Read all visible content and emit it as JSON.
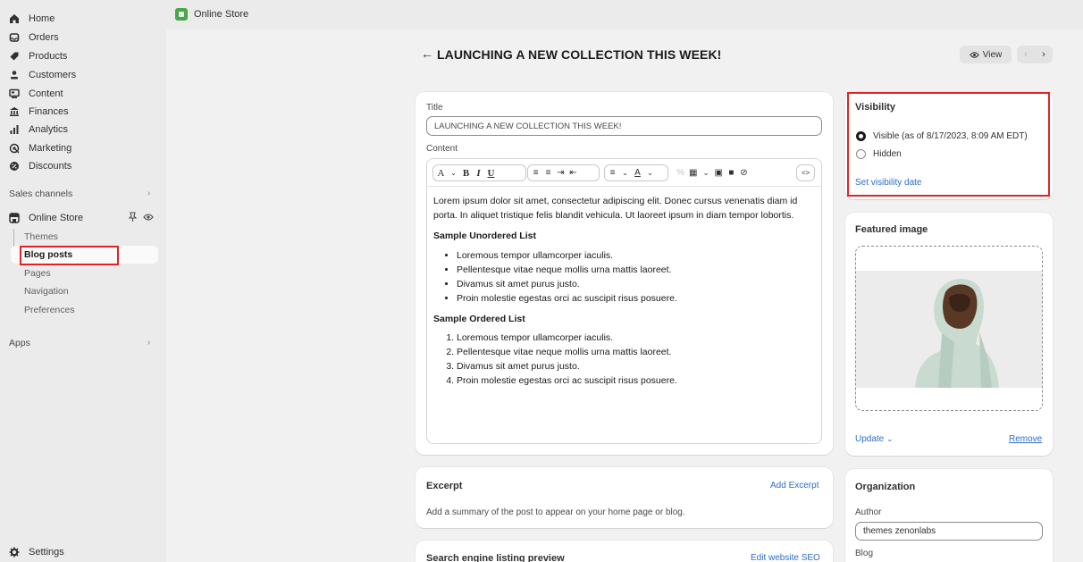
{
  "sidebar": {
    "items": [
      {
        "label": "Home",
        "icon": "home-icon"
      },
      {
        "label": "Orders",
        "icon": "inbox-icon"
      },
      {
        "label": "Products",
        "icon": "tag-icon"
      },
      {
        "label": "Customers",
        "icon": "person-icon"
      },
      {
        "label": "Content",
        "icon": "content-icon"
      },
      {
        "label": "Finances",
        "icon": "bank-icon"
      },
      {
        "label": "Analytics",
        "icon": "bar-chart-icon"
      },
      {
        "label": "Marketing",
        "icon": "target-icon"
      },
      {
        "label": "Discounts",
        "icon": "discount-icon"
      }
    ],
    "sales_channels_label": "Sales channels",
    "online_store": {
      "label": "Online Store",
      "sub_items": [
        "Themes",
        "Blog posts",
        "Pages",
        "Navigation",
        "Preferences"
      ],
      "active_sub_item": "Blog posts"
    },
    "apps_label": "Apps",
    "settings_label": "Settings"
  },
  "topbar": {
    "store_name": "Online Store"
  },
  "header": {
    "back_arrow": "←",
    "title": "LAUNCHING A NEW COLLECTION THIS WEEK!",
    "view_label": "View",
    "prev": "‹",
    "next": "›"
  },
  "post": {
    "title_label": "Title",
    "title_value": "LAUNCHING A NEW COLLECTION THIS WEEK!",
    "content_label": "Content",
    "toolbar": {
      "text_style": "A",
      "bold": "B",
      "italic": "I",
      "underline": "U",
      "text_color": "A",
      "source": "<>"
    },
    "body": {
      "paragraph": "Lorem ipsum dolor sit amet, consectetur adipiscing elit. Donec cursus venenatis diam id porta. In aliquet tristique felis blandit vehicula. Ut laoreet ipsum in diam tempor lobortis.",
      "ul_heading": "Sample Unordered List",
      "ul_items": [
        "Loremous tempor ullamcorper iaculis.",
        "Pellentesque vitae neque mollis urna mattis laoreet.",
        "Divamus sit amet purus justo.",
        "Proin molestie egestas orci ac suscipit risus posuere."
      ],
      "ol_heading": "Sample Ordered List",
      "ol_items": [
        "Loremous tempor ullamcorper iaculis.",
        "Pellentesque vitae neque mollis urna mattis laoreet.",
        "Divamus sit amet purus justo.",
        "Proin molestie egestas orci ac suscipit risus posuere."
      ]
    }
  },
  "excerpt": {
    "title": "Excerpt",
    "action": "Add Excerpt",
    "description": "Add a summary of the post to appear on your home page or blog."
  },
  "seo": {
    "title": "Search engine listing preview",
    "action": "Edit website SEO"
  },
  "visibility": {
    "title": "Visibility",
    "visible_label": "Visible (as of 8/17/2023, 8:09 AM EDT)",
    "hidden_label": "Hidden",
    "selected": "visible",
    "set_date_link": "Set visibility date"
  },
  "featured_image": {
    "title": "Featured image",
    "update_label": "Update",
    "remove_label": "Remove"
  },
  "organization": {
    "title": "Organization",
    "author_label": "Author",
    "author_value": "themes zenonlabs",
    "blog_label": "Blog"
  },
  "colors": {
    "highlight": "#e02424",
    "link": "#2c6ecb",
    "sidebar_bg": "#ebebeb",
    "page_bg": "#f1f1f1"
  }
}
